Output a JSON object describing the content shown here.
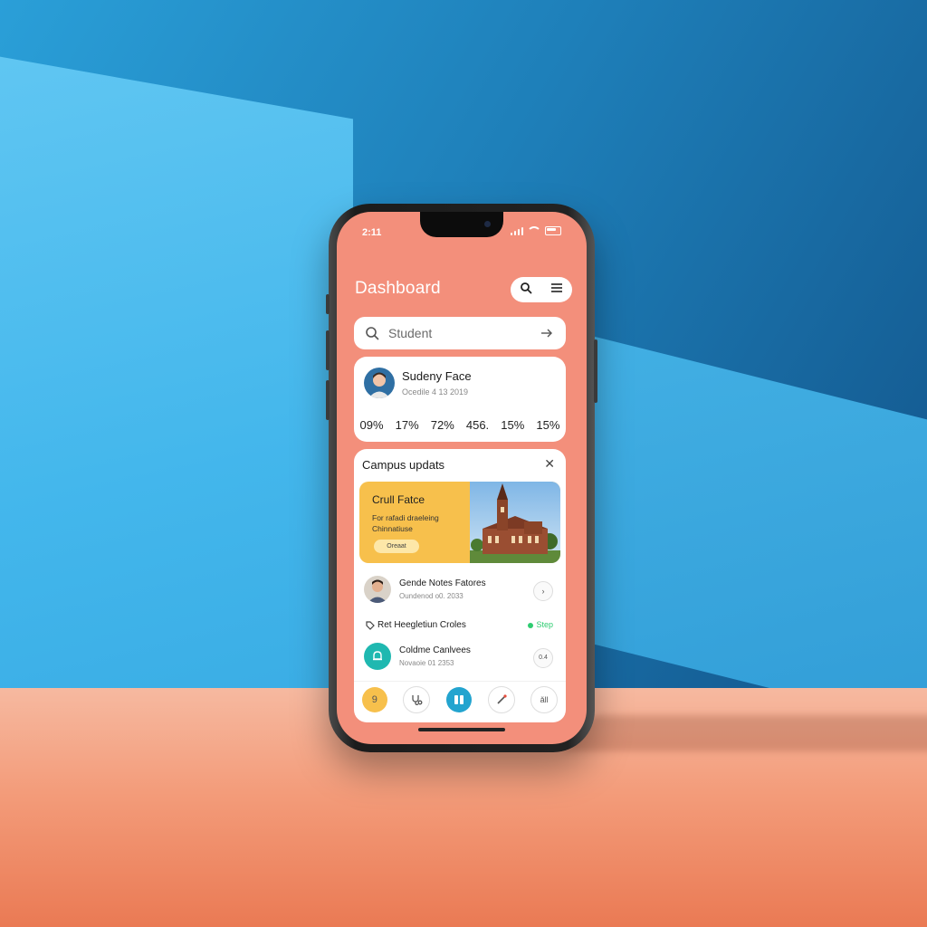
{
  "status": {
    "time": "2:11"
  },
  "header": {
    "title": "Dashboard"
  },
  "search": {
    "text": "Student"
  },
  "profile": {
    "name": "Sudeny Face",
    "subtitle": "Ocedile 4 13 2019",
    "stats": [
      "09%",
      "17%",
      "72%",
      "456.",
      "15%",
      "15%"
    ]
  },
  "updates": {
    "title": "Campus updats",
    "feature": {
      "title": "Crull Fatce",
      "description": "For rafadi draeleing Chinnatiuse",
      "button_label": "Oreaat"
    },
    "items": [
      {
        "title": "Gende Notes Fatores",
        "subtitle": "Oundenod o0. 2033",
        "action": "›"
      },
      {
        "title": "Ret Heegletiun Croles",
        "badge": "Step"
      },
      {
        "title": "Coldme Canlvees",
        "subtitle": "Novaoie 01 2353",
        "action": "0.4"
      }
    ]
  },
  "nav": {
    "items": [
      "9",
      "",
      "",
      "",
      "ǎll"
    ]
  },
  "colors": {
    "screen": "#f38f7b",
    "accent_yellow": "#f7c04c",
    "accent_teal": "#1fb8b0",
    "nav_active": "#23a4cf"
  }
}
